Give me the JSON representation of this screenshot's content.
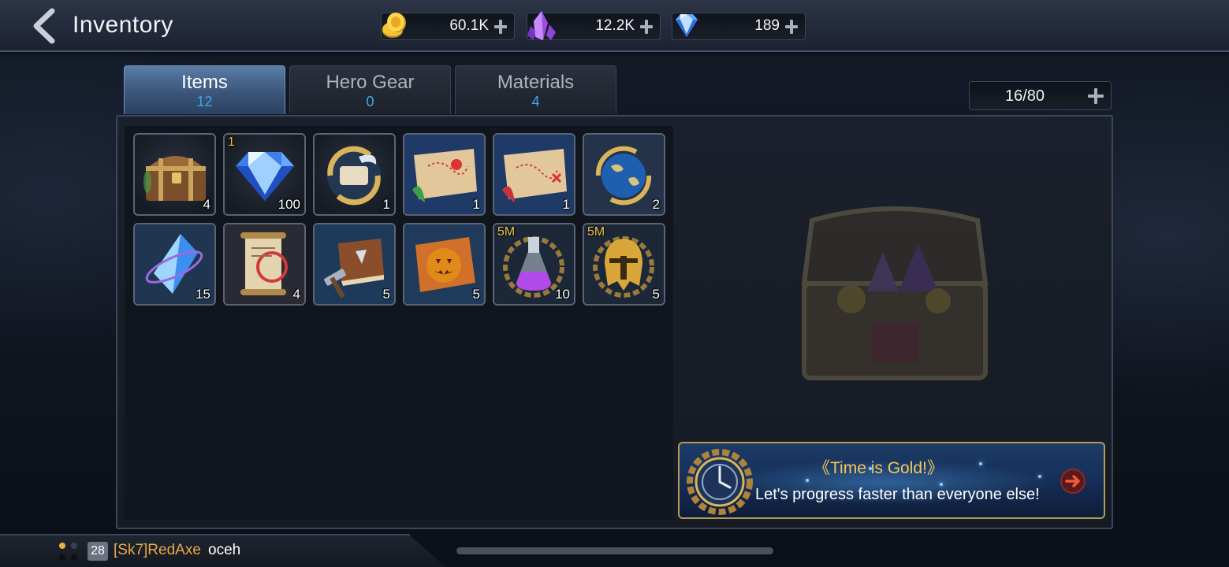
{
  "header": {
    "title": "Inventory"
  },
  "resources": [
    {
      "icon": "gold-coin-icon",
      "value": "60.1K"
    },
    {
      "icon": "purple-crystal-icon",
      "value": "12.2K"
    },
    {
      "icon": "diamond-icon",
      "value": "189"
    }
  ],
  "tabs": [
    {
      "label": "Items",
      "count": "12",
      "active": true
    },
    {
      "label": "Hero Gear",
      "count": "0",
      "active": false
    },
    {
      "label": "Materials",
      "count": "4",
      "active": false
    }
  ],
  "capacity": {
    "value": "16/80"
  },
  "items": [
    {
      "icon": "treasure-chest-icon",
      "qty": "4",
      "tag": ""
    },
    {
      "icon": "diamond-gem-icon",
      "qty": "100",
      "tag": "1"
    },
    {
      "icon": "rotating-scroll-icon",
      "qty": "1",
      "tag": ""
    },
    {
      "icon": "green-ribbon-map-icon",
      "qty": "1",
      "tag": ""
    },
    {
      "icon": "red-ribbon-map-icon",
      "qty": "1",
      "tag": ""
    },
    {
      "icon": "globe-teleport-icon",
      "qty": "2",
      "tag": ""
    },
    {
      "icon": "blue-crystal-shard-icon",
      "qty": "15",
      "tag": ""
    },
    {
      "icon": "ancient-scroll-icon",
      "qty": "4",
      "tag": ""
    },
    {
      "icon": "book-hammer-icon",
      "qty": "5",
      "tag": ""
    },
    {
      "icon": "pumpkin-card-icon",
      "qty": "5",
      "tag": ""
    },
    {
      "icon": "purple-potion-icon",
      "qty": "10",
      "tag": "5M"
    },
    {
      "icon": "golden-helmet-icon",
      "qty": "5",
      "tag": "5M"
    }
  ],
  "banner": {
    "title": "《Time is Gold!》",
    "subtitle": "Let's progress faster than everyone else!"
  },
  "chat": {
    "level": "28",
    "name": "[Sk7]RedAxe",
    "message": "oceh"
  },
  "colors": {
    "accent_blue": "#3fa4ee",
    "gold_text": "#f3c85a",
    "active_tab": "#3b5679"
  }
}
